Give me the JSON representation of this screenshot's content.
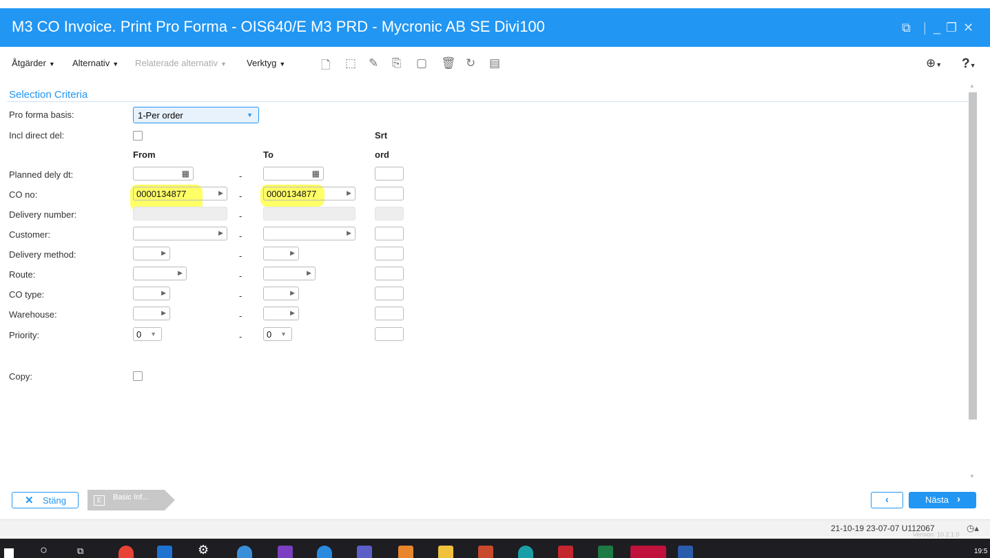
{
  "window": {
    "title": "M3 CO Invoice. Print Pro Forma - OIS640/E   M3 PRD - Mycronic AB    SE Divi100"
  },
  "menu": {
    "actions": "Åtgärder",
    "options": "Alternativ",
    "related": "Relaterade alternativ",
    "tools": "Verktyg"
  },
  "section": {
    "title": "Selection Criteria"
  },
  "form": {
    "pro_forma_basis_label": "Pro forma basis:",
    "pro_forma_basis_value": "1-Per order",
    "incl_direct_del_label": "Incl direct del:",
    "header_srt": "Srt",
    "header_from": "From",
    "header_to": "To",
    "header_ord": "ord",
    "planned_dely_label": "Planned dely dt:",
    "co_no_label": "CO no:",
    "co_no_from": "0000134877",
    "co_no_to": "0000134877",
    "delivery_number_label": "Delivery number:",
    "customer_label": "Customer:",
    "delivery_method_label": "Delivery method:",
    "route_label": "Route:",
    "co_type_label": "CO type:",
    "warehouse_label": "Warehouse:",
    "priority_label": "Priority:",
    "priority_from": "0",
    "priority_to": "0",
    "copy_label": "Copy:",
    "dash": "-"
  },
  "footer": {
    "close_label": "Stäng",
    "panel_letter": "E",
    "panel_label": "Basic Inf...",
    "next_label": "Nästa"
  },
  "status": {
    "text": "21-10-19 23-07-07 U112067",
    "version": "Version: 10.2.1.0"
  },
  "taskbar": {
    "time": "19:5"
  },
  "colors": {
    "accent": "#2196f3",
    "highlight": "#ffff00"
  }
}
